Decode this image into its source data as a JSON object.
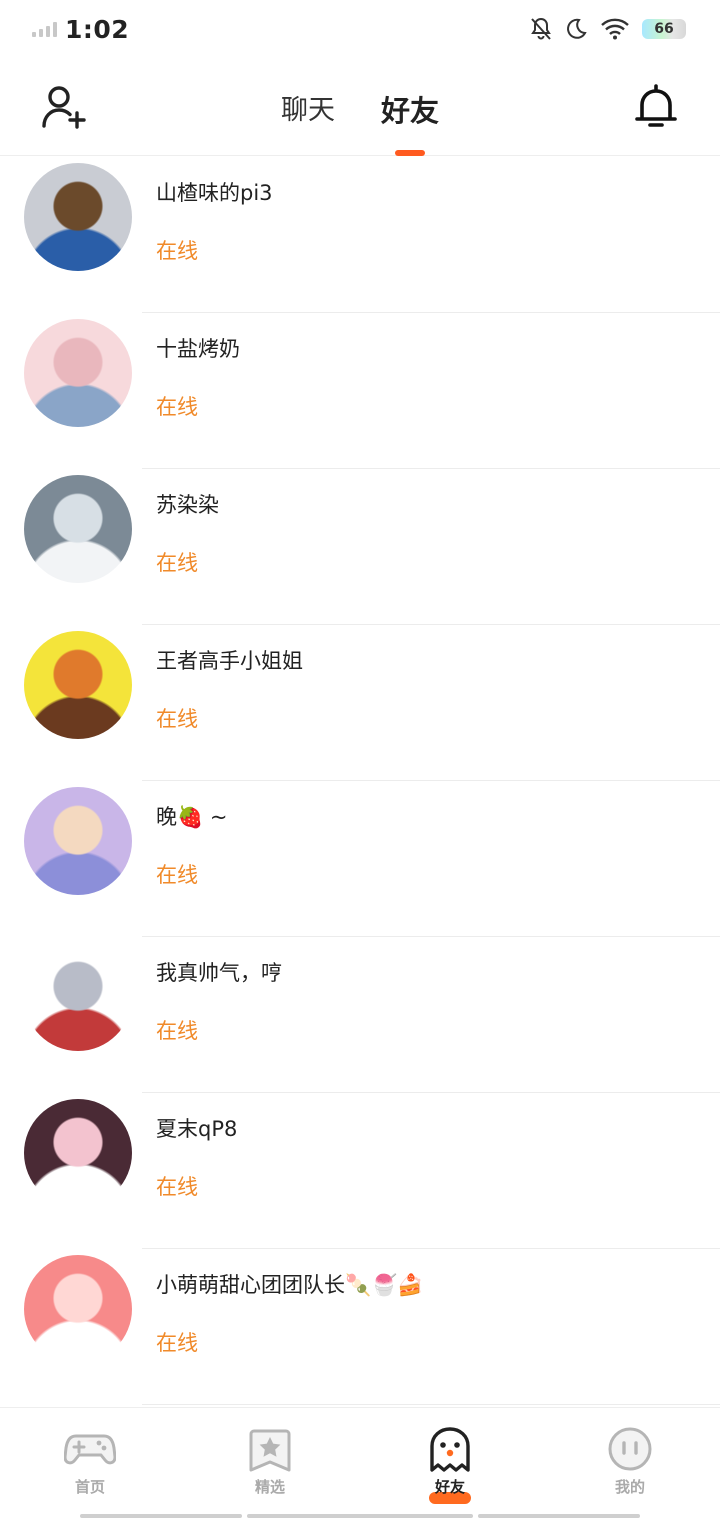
{
  "status_bar": {
    "time": "1:02",
    "battery": "66",
    "icons": [
      "signal-icon",
      "bell-muted-icon",
      "moon-icon",
      "wifi-icon",
      "battery-icon"
    ]
  },
  "header": {
    "tabs": [
      {
        "label": "聊天",
        "active": false
      },
      {
        "label": "好友",
        "active": true
      }
    ],
    "left_icon": "add-friend-icon",
    "right_icon": "bell-icon",
    "accent_color": "#ff5a1f"
  },
  "friends": [
    {
      "name": "山楂味的pi3",
      "status": "在线",
      "avatar_colors": [
        "#c9ccd3",
        "#6b4a2b",
        "#2a5ea8"
      ]
    },
    {
      "name": "十盐烤奶",
      "status": "在线",
      "avatar_colors": [
        "#f7d9dc",
        "#e9b7bd",
        "#8aa5c8"
      ]
    },
    {
      "name": "苏染染",
      "status": "在线",
      "avatar_colors": [
        "#7c8a96",
        "#d7dfe5",
        "#f2f4f6"
      ]
    },
    {
      "name": "王者高手小姐姐",
      "status": "在线",
      "avatar_colors": [
        "#f4e43a",
        "#e07a2c",
        "#6b3a1f"
      ]
    },
    {
      "name": "晚🍓 ~",
      "status": "在线",
      "avatar_colors": [
        "#c9b6e8",
        "#f4d9c0",
        "#8c8fd9"
      ]
    },
    {
      "name": "我真帅气，哼",
      "status": "在线",
      "avatar_colors": [
        "#ffffff",
        "#b8bcc8",
        "#c23a3a"
      ]
    },
    {
      "name": "夏末qP8",
      "status": "在线",
      "avatar_colors": [
        "#4a2a35",
        "#f3c3cf",
        "#ffffff"
      ]
    },
    {
      "name": "小萌萌甜心团团队长🍡🍧🍰",
      "status": "在线",
      "avatar_colors": [
        "#f78a8a",
        "#ffd7d4",
        "#ffffff"
      ]
    }
  ],
  "status_color": "#f08a2a",
  "bottom_nav": [
    {
      "label": "首页",
      "icon": "gamepad-icon",
      "active": false
    },
    {
      "label": "精选",
      "icon": "star-bookmark-icon",
      "active": false
    },
    {
      "label": "好友",
      "icon": "ghost-icon",
      "active": true
    },
    {
      "label": "我的",
      "icon": "face-icon",
      "active": false
    }
  ]
}
